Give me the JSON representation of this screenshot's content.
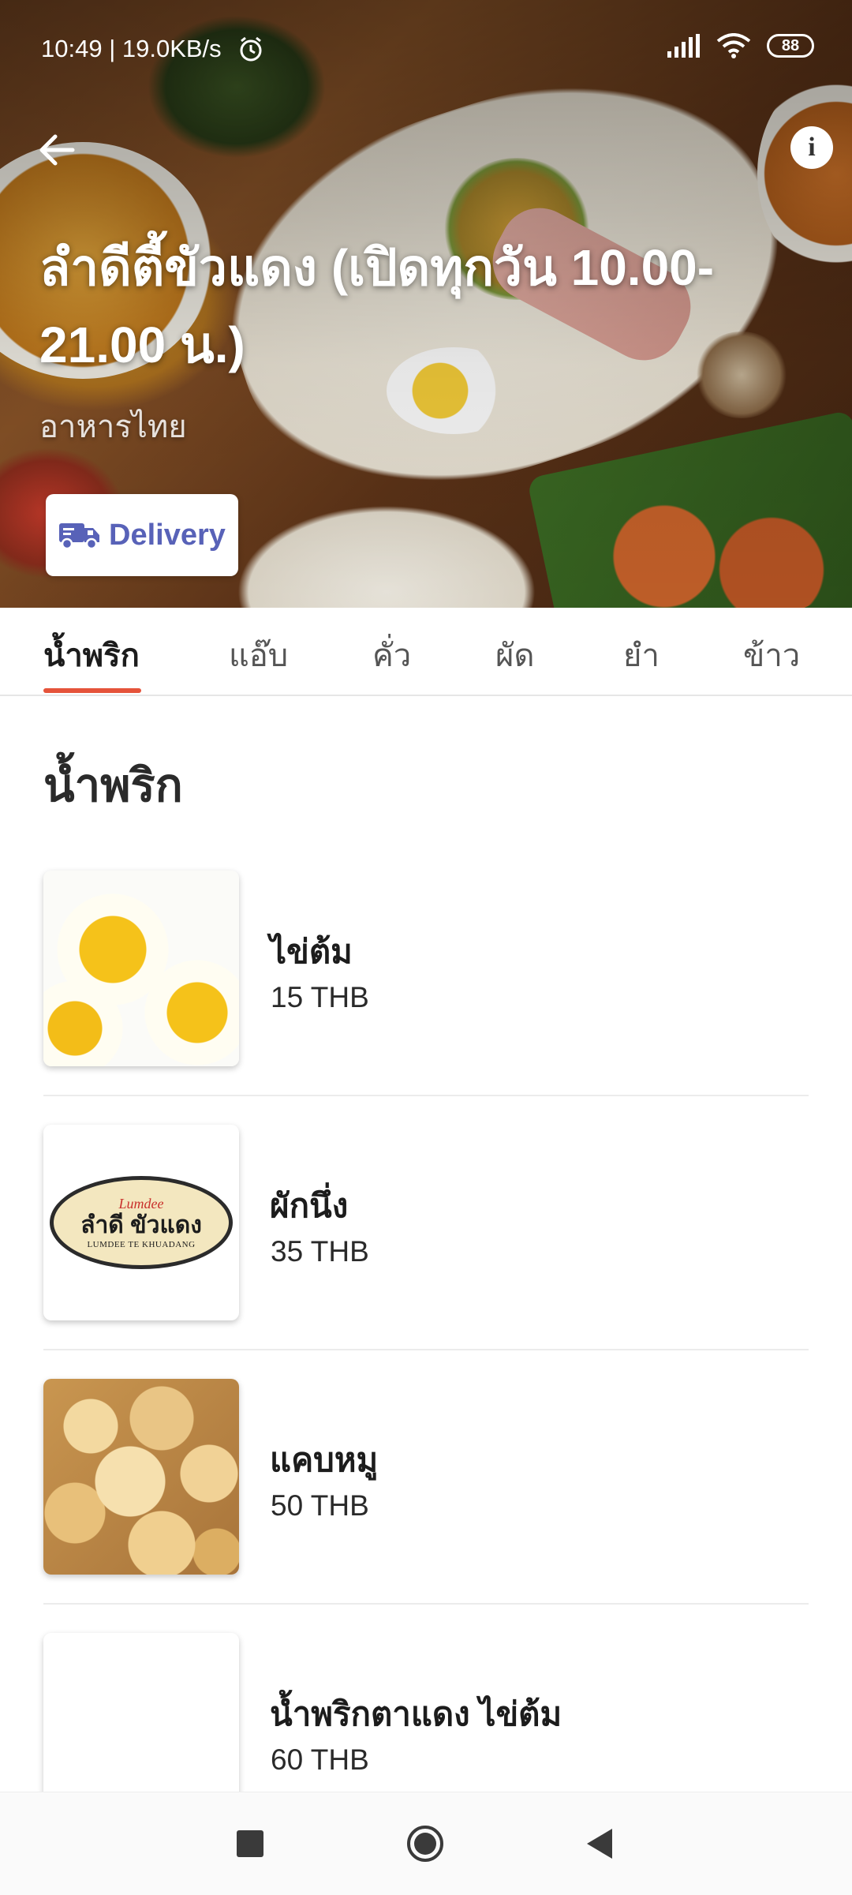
{
  "status_bar": {
    "time_speed": "10:49 | 19.0KB/s",
    "battery": "88"
  },
  "store": {
    "title": "ลำดีตี้ขัวแดง (เปิดทุกวัน 10.00-21.00 น.)",
    "cuisine": "อาหารไทย",
    "delivery_label": "Delivery"
  },
  "tabs": [
    {
      "label": "น้ำพริก",
      "active": true
    },
    {
      "label": "แอ๊บ"
    },
    {
      "label": "คั่ว"
    },
    {
      "label": "ผัด"
    },
    {
      "label": "ยำ"
    },
    {
      "label": "ข้าว"
    }
  ],
  "section": {
    "title": "น้ำพริก"
  },
  "menu_items": [
    {
      "name": "ไข่ต้ม",
      "price": "15 THB"
    },
    {
      "name": "ผักนึ่ง",
      "price": "35 THB"
    },
    {
      "name": "แคบหมู",
      "price": "50 THB"
    },
    {
      "name": "น้ำพริกตาแดง ไข่ต้ม",
      "price": "60 THB"
    }
  ],
  "logo": {
    "script": "Lumdee",
    "thai": "ลำดี ขัวแดง",
    "english": "LUMDEE TE KHUADANG"
  },
  "colors": {
    "accent": "#e5533a",
    "delivery": "#5862b8"
  },
  "icons": {
    "back": "arrow-left-icon",
    "info": "info-icon",
    "delivery": "truck-icon"
  }
}
